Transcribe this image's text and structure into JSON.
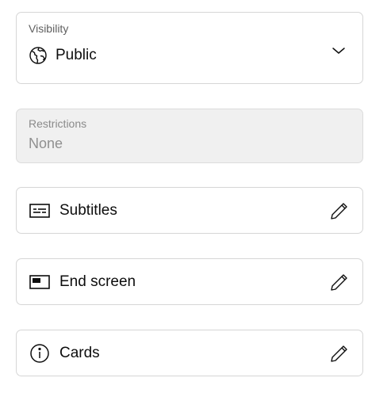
{
  "visibility": {
    "label": "Visibility",
    "value": "Public",
    "icon": "globe-icon",
    "dropdown_icon": "chevron-down-icon"
  },
  "restrictions": {
    "label": "Restrictions",
    "value": "None"
  },
  "items": [
    {
      "label": "Subtitles",
      "icon": "subtitles-icon",
      "action_icon": "pencil-icon"
    },
    {
      "label": "End screen",
      "icon": "end-screen-icon",
      "action_icon": "pencil-icon"
    },
    {
      "label": "Cards",
      "icon": "info-icon",
      "action_icon": "pencil-icon"
    }
  ],
  "colors": {
    "text": "#0d0d0d",
    "label": "#606060",
    "border": "#d6d6d6",
    "disabled_bg": "#f0f0f0"
  }
}
